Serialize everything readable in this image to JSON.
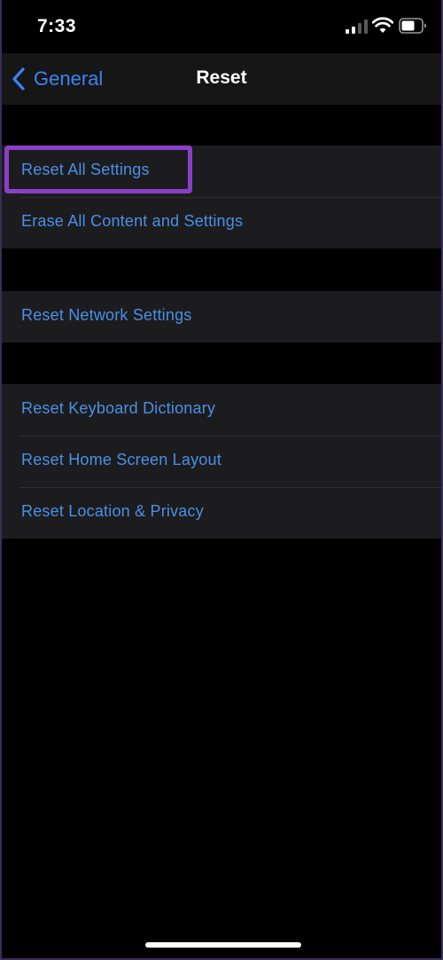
{
  "status_bar": {
    "time": "7:33",
    "icons": [
      "signal-icon",
      "wifi-icon",
      "battery-icon"
    ]
  },
  "nav": {
    "back_label": "General",
    "title": "Reset"
  },
  "groups": [
    {
      "items": [
        {
          "label": "Reset All Settings",
          "highlighted": true
        },
        {
          "label": "Erase All Content and Settings"
        }
      ]
    },
    {
      "items": [
        {
          "label": "Reset Network Settings"
        }
      ]
    },
    {
      "items": [
        {
          "label": "Reset Keyboard Dictionary"
        },
        {
          "label": "Reset Home Screen Layout"
        },
        {
          "label": "Reset Location & Privacy"
        }
      ]
    }
  ],
  "colors": {
    "accent": "#4a8fe7",
    "highlight": "#8b3fc8",
    "background": "#000000",
    "cell": "#1c1c1e"
  }
}
